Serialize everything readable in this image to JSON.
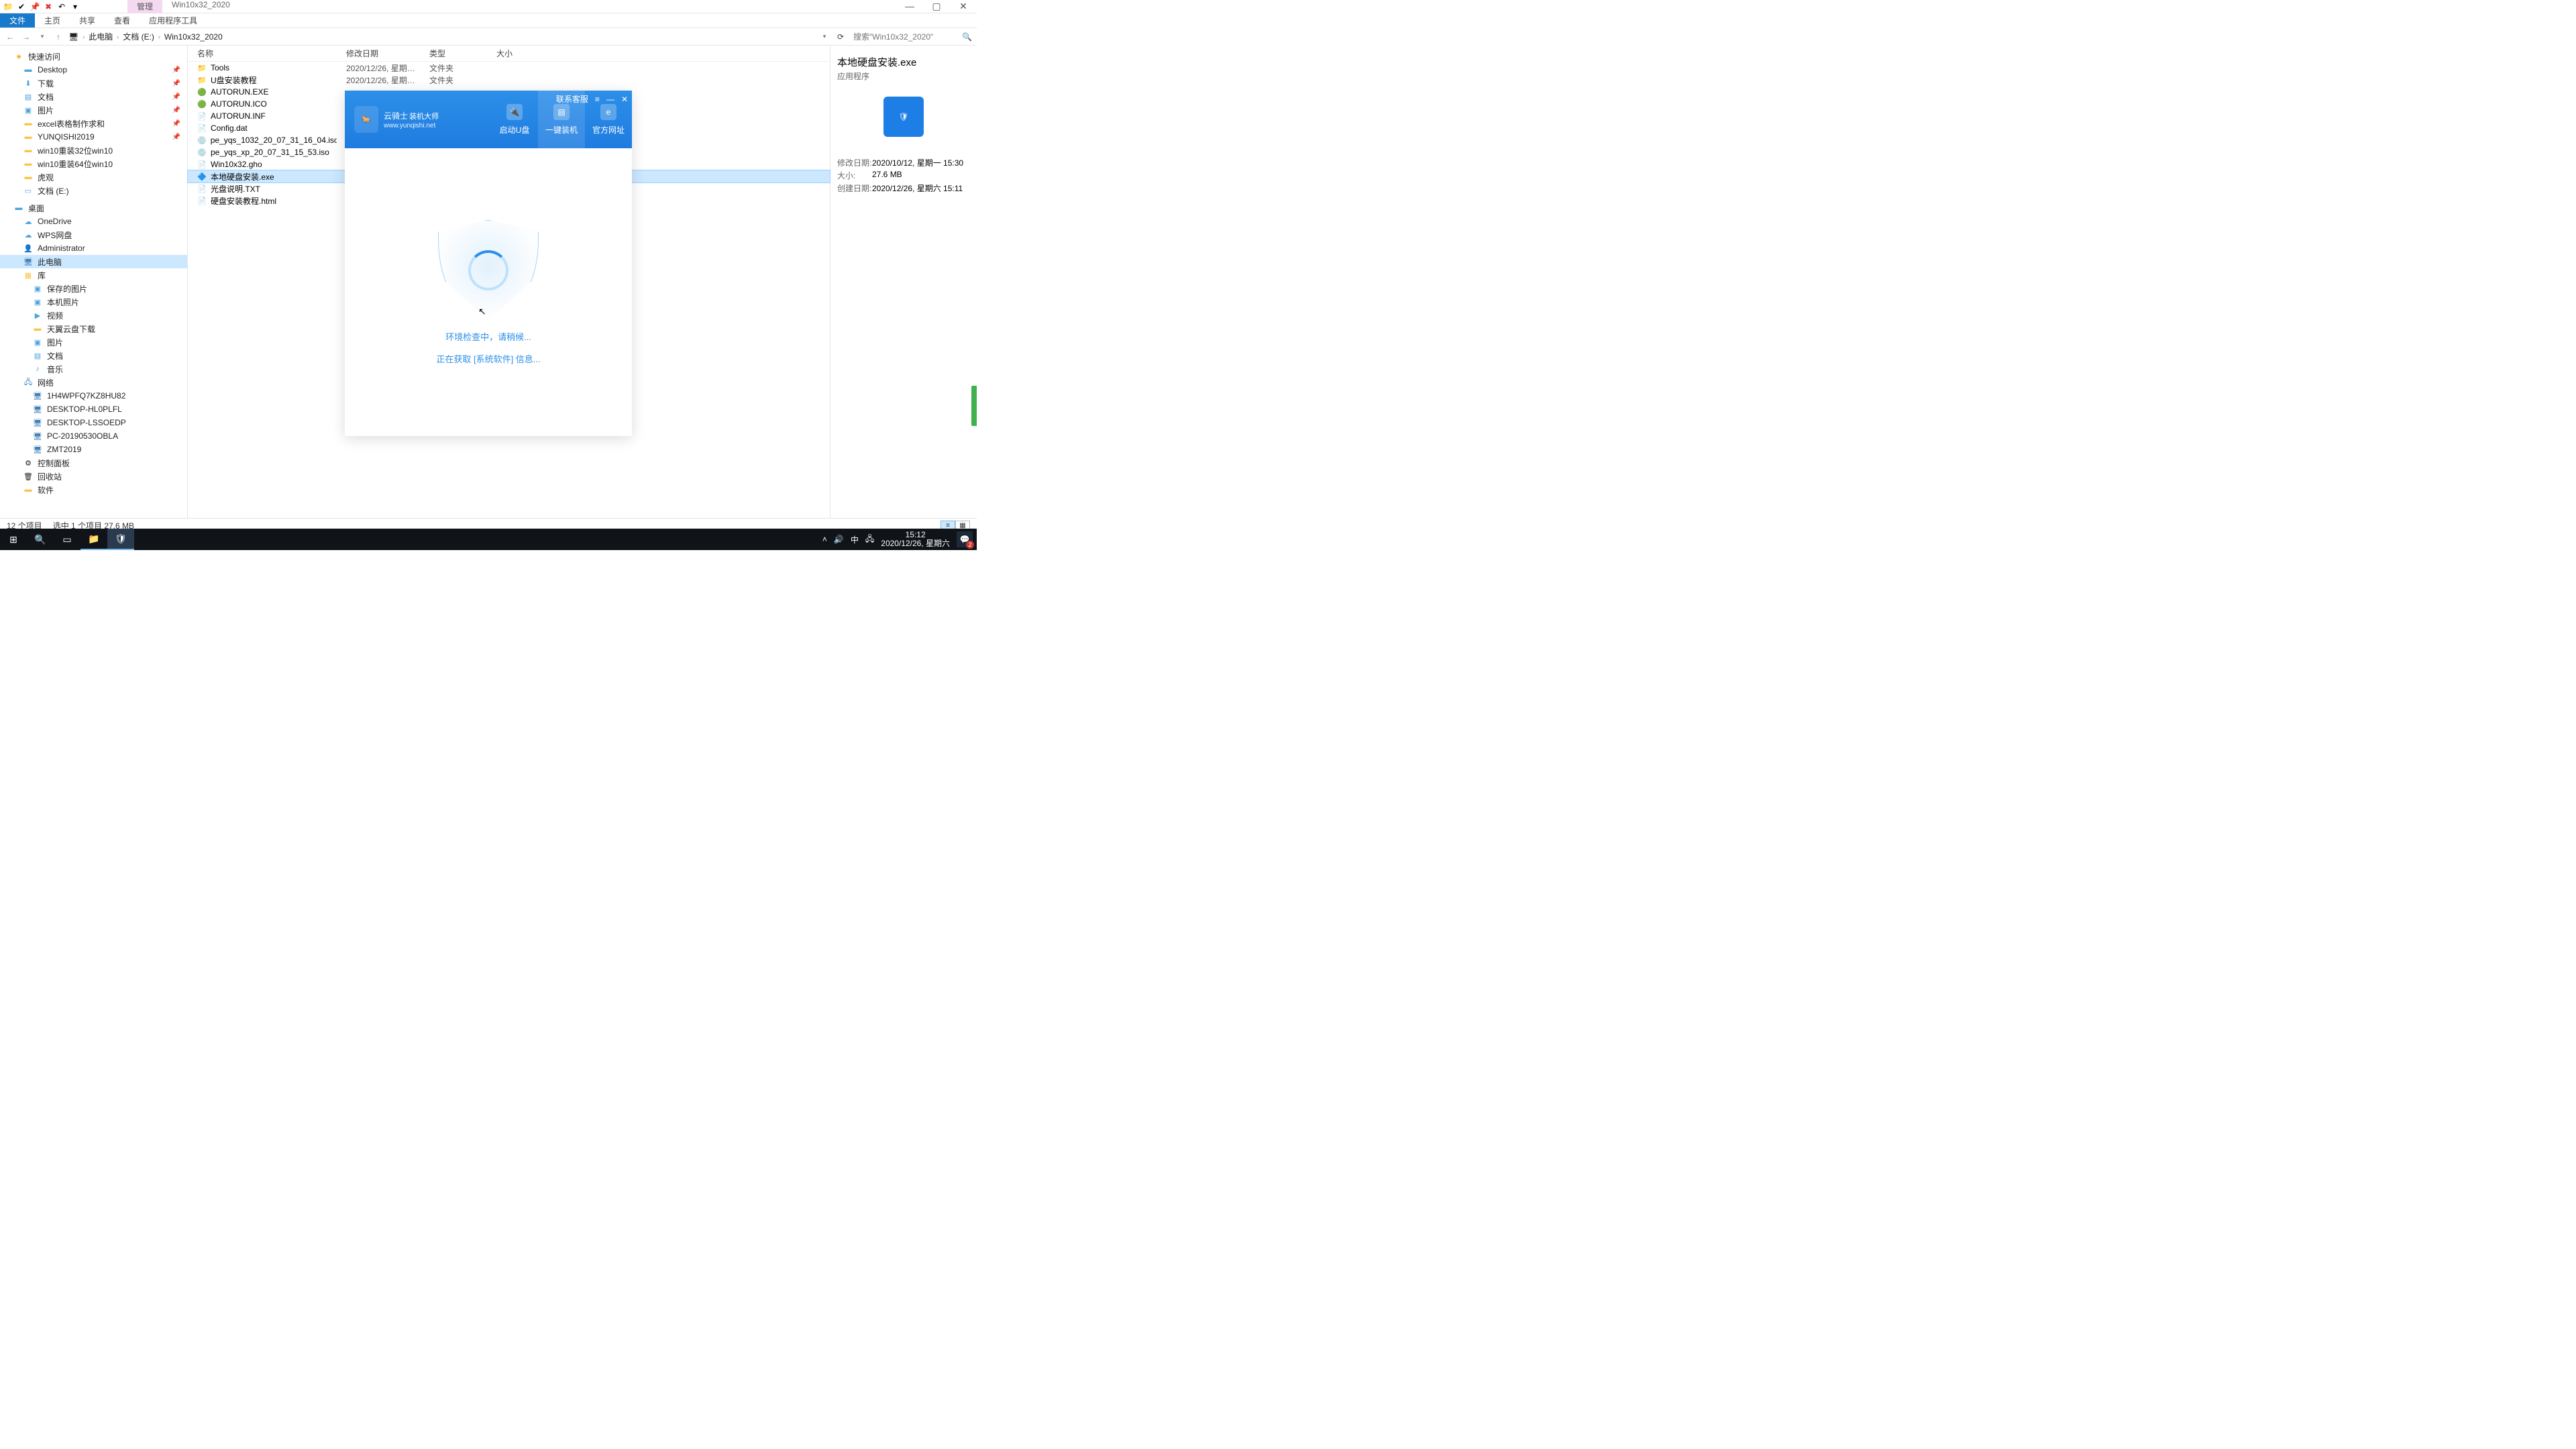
{
  "titlebar": {
    "ctx_tab": "管理",
    "win_title": "Win10x32_2020"
  },
  "ribbon": {
    "file": "文件",
    "home": "主页",
    "share": "共享",
    "view": "查看",
    "app_tools": "应用程序工具"
  },
  "address": {
    "crumbs": [
      "此电脑",
      "文档 (E:)",
      "Win10x32_2020"
    ],
    "search_placeholder": "搜索\"Win10x32_2020\""
  },
  "nav": {
    "quick": "快速访问",
    "items_quick": [
      "Desktop",
      "下载",
      "文档",
      "图片",
      "excel表格制作求和",
      "YUNQISHI2019",
      "win10重装32位win10",
      "win10重装64位win10",
      "虎观",
      "文档 (E:)"
    ],
    "desktop": "桌面",
    "desktop_kids": [
      "OneDrive",
      "WPS网盘",
      "Administrator",
      "此电脑",
      "库"
    ],
    "lib_kids": [
      "保存的图片",
      "本机照片",
      "视频",
      "天翼云盘下载",
      "图片",
      "文档",
      "音乐"
    ],
    "network": "网络",
    "net_kids": [
      "1H4WPFQ7KZ8HU82",
      "DESKTOP-HL0PLFL",
      "DESKTOP-LSSOEDP",
      "PC-20190530OBLA",
      "ZMT2019"
    ],
    "ctrl_panel": "控制面板",
    "recycle": "回收站",
    "software": "软件"
  },
  "columns": {
    "name": "名称",
    "date": "修改日期",
    "type": "类型",
    "size": "大小"
  },
  "files": [
    {
      "name": "Tools",
      "date": "2020/12/26, 星期六 1...",
      "type": "文件夹",
      "size": "",
      "ico": "📁"
    },
    {
      "name": "U盘安装教程",
      "date": "2020/12/26, 星期六 1...",
      "type": "文件夹",
      "size": "",
      "ico": "📁"
    },
    {
      "name": "AUTORUN.EXE",
      "date": "",
      "type": "",
      "size": "",
      "ico": "🟢"
    },
    {
      "name": "AUTORUN.ICO",
      "date": "",
      "type": "",
      "size": "",
      "ico": "🟢"
    },
    {
      "name": "AUTORUN.INF",
      "date": "",
      "type": "",
      "size": "",
      "ico": "📄"
    },
    {
      "name": "Config.dat",
      "date": "",
      "type": "",
      "size": "",
      "ico": "📄"
    },
    {
      "name": "pe_yqs_1032_20_07_31_16_04.iso",
      "date": "",
      "type": "",
      "size": "",
      "ico": "💿"
    },
    {
      "name": "pe_yqs_xp_20_07_31_15_53.iso",
      "date": "",
      "type": "",
      "size": "",
      "ico": "💿"
    },
    {
      "name": "Win10x32.gho",
      "date": "",
      "type": "",
      "size": "",
      "ico": "📄"
    },
    {
      "name": "本地硬盘安装.exe",
      "date": "",
      "type": "",
      "size": "",
      "ico": "🔷",
      "sel": true
    },
    {
      "name": "光盘说明.TXT",
      "date": "",
      "type": "",
      "size": "",
      "ico": "📄"
    },
    {
      "name": "硬盘安装教程.html",
      "date": "",
      "type": "",
      "size": "",
      "ico": "📄"
    }
  ],
  "details": {
    "title": "本地硬盘安装.exe",
    "sub": "应用程序",
    "meta": [
      {
        "k": "修改日期:",
        "v": "2020/10/12, 星期一 15:30"
      },
      {
        "k": "大小:",
        "v": "27.6 MB"
      },
      {
        "k": "创建日期:",
        "v": "2020/12/26, 星期六 15:11"
      }
    ]
  },
  "status": {
    "count": "12 个项目",
    "sel": "选中 1 个项目  27.6 MB"
  },
  "modal": {
    "brand": "云骑士",
    "brand_sub": "装机大师",
    "url": "www.yunqishi.net",
    "contact": "联系客服",
    "tabs": [
      "启动U盘",
      "一键装机",
      "官方网址"
    ],
    "line1": "环境检查中，请稍候...",
    "line2": "正在获取 [系统软件] 信息..."
  },
  "tray": {
    "time": "15:12",
    "date": "2020/12/26, 星期六",
    "ime": "中",
    "notif_count": "2"
  }
}
